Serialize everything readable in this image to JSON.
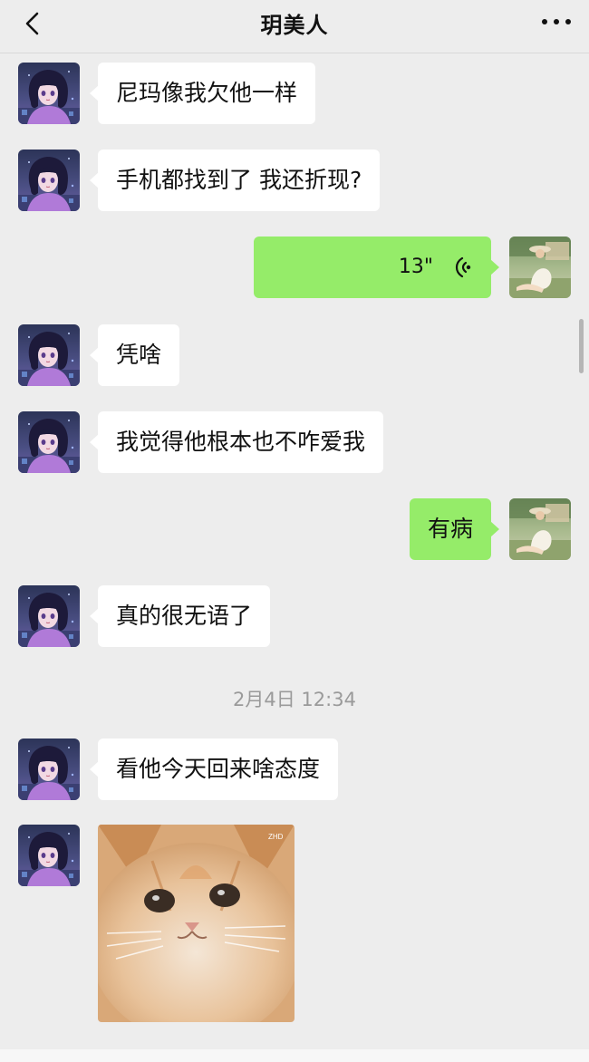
{
  "header": {
    "title": "玥美人"
  },
  "messages": [
    {
      "text": "尼玛像我欠他一样"
    },
    {
      "text": "手机都找到了 我还折现?"
    },
    {
      "duration": "13\""
    },
    {
      "text": "凭啥"
    },
    {
      "text": "我觉得他根本也不咋爱我"
    },
    {
      "text": "有病"
    },
    {
      "text": "真的很无语了"
    },
    {
      "text": "看他今天回来啥态度"
    }
  ],
  "timestamp": "2月4日 12:34",
  "sticker": {
    "watermark": "ZHD"
  },
  "colors": {
    "background": "#ededed",
    "incoming_bubble": "#ffffff",
    "outgoing_bubble": "#95ec69",
    "timestamp_text": "#9a9a9a"
  },
  "icons": [
    "back-arrow-icon",
    "more-dots-icon",
    "voice-wave-icon"
  ]
}
